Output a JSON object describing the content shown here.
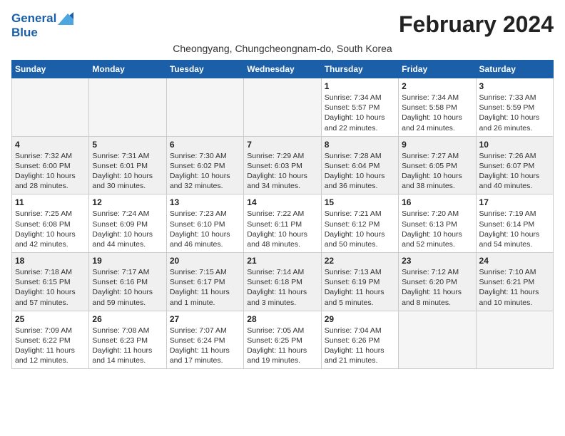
{
  "header": {
    "logo_general": "General",
    "logo_blue": "Blue",
    "month_title": "February 2024",
    "subtitle": "Cheongyang, Chungcheongnam-do, South Korea"
  },
  "weekdays": [
    "Sunday",
    "Monday",
    "Tuesday",
    "Wednesday",
    "Thursday",
    "Friday",
    "Saturday"
  ],
  "weeks": [
    [
      {
        "day": "",
        "info": ""
      },
      {
        "day": "",
        "info": ""
      },
      {
        "day": "",
        "info": ""
      },
      {
        "day": "",
        "info": ""
      },
      {
        "day": "1",
        "info": "Sunrise: 7:34 AM\nSunset: 5:57 PM\nDaylight: 10 hours\nand 22 minutes."
      },
      {
        "day": "2",
        "info": "Sunrise: 7:34 AM\nSunset: 5:58 PM\nDaylight: 10 hours\nand 24 minutes."
      },
      {
        "day": "3",
        "info": "Sunrise: 7:33 AM\nSunset: 5:59 PM\nDaylight: 10 hours\nand 26 minutes."
      }
    ],
    [
      {
        "day": "4",
        "info": "Sunrise: 7:32 AM\nSunset: 6:00 PM\nDaylight: 10 hours\nand 28 minutes."
      },
      {
        "day": "5",
        "info": "Sunrise: 7:31 AM\nSunset: 6:01 PM\nDaylight: 10 hours\nand 30 minutes."
      },
      {
        "day": "6",
        "info": "Sunrise: 7:30 AM\nSunset: 6:02 PM\nDaylight: 10 hours\nand 32 minutes."
      },
      {
        "day": "7",
        "info": "Sunrise: 7:29 AM\nSunset: 6:03 PM\nDaylight: 10 hours\nand 34 minutes."
      },
      {
        "day": "8",
        "info": "Sunrise: 7:28 AM\nSunset: 6:04 PM\nDaylight: 10 hours\nand 36 minutes."
      },
      {
        "day": "9",
        "info": "Sunrise: 7:27 AM\nSunset: 6:05 PM\nDaylight: 10 hours\nand 38 minutes."
      },
      {
        "day": "10",
        "info": "Sunrise: 7:26 AM\nSunset: 6:07 PM\nDaylight: 10 hours\nand 40 minutes."
      }
    ],
    [
      {
        "day": "11",
        "info": "Sunrise: 7:25 AM\nSunset: 6:08 PM\nDaylight: 10 hours\nand 42 minutes."
      },
      {
        "day": "12",
        "info": "Sunrise: 7:24 AM\nSunset: 6:09 PM\nDaylight: 10 hours\nand 44 minutes."
      },
      {
        "day": "13",
        "info": "Sunrise: 7:23 AM\nSunset: 6:10 PM\nDaylight: 10 hours\nand 46 minutes."
      },
      {
        "day": "14",
        "info": "Sunrise: 7:22 AM\nSunset: 6:11 PM\nDaylight: 10 hours\nand 48 minutes."
      },
      {
        "day": "15",
        "info": "Sunrise: 7:21 AM\nSunset: 6:12 PM\nDaylight: 10 hours\nand 50 minutes."
      },
      {
        "day": "16",
        "info": "Sunrise: 7:20 AM\nSunset: 6:13 PM\nDaylight: 10 hours\nand 52 minutes."
      },
      {
        "day": "17",
        "info": "Sunrise: 7:19 AM\nSunset: 6:14 PM\nDaylight: 10 hours\nand 54 minutes."
      }
    ],
    [
      {
        "day": "18",
        "info": "Sunrise: 7:18 AM\nSunset: 6:15 PM\nDaylight: 10 hours\nand 57 minutes."
      },
      {
        "day": "19",
        "info": "Sunrise: 7:17 AM\nSunset: 6:16 PM\nDaylight: 10 hours\nand 59 minutes."
      },
      {
        "day": "20",
        "info": "Sunrise: 7:15 AM\nSunset: 6:17 PM\nDaylight: 11 hours\nand 1 minute."
      },
      {
        "day": "21",
        "info": "Sunrise: 7:14 AM\nSunset: 6:18 PM\nDaylight: 11 hours\nand 3 minutes."
      },
      {
        "day": "22",
        "info": "Sunrise: 7:13 AM\nSunset: 6:19 PM\nDaylight: 11 hours\nand 5 minutes."
      },
      {
        "day": "23",
        "info": "Sunrise: 7:12 AM\nSunset: 6:20 PM\nDaylight: 11 hours\nand 8 minutes."
      },
      {
        "day": "24",
        "info": "Sunrise: 7:10 AM\nSunset: 6:21 PM\nDaylight: 11 hours\nand 10 minutes."
      }
    ],
    [
      {
        "day": "25",
        "info": "Sunrise: 7:09 AM\nSunset: 6:22 PM\nDaylight: 11 hours\nand 12 minutes."
      },
      {
        "day": "26",
        "info": "Sunrise: 7:08 AM\nSunset: 6:23 PM\nDaylight: 11 hours\nand 14 minutes."
      },
      {
        "day": "27",
        "info": "Sunrise: 7:07 AM\nSunset: 6:24 PM\nDaylight: 11 hours\nand 17 minutes."
      },
      {
        "day": "28",
        "info": "Sunrise: 7:05 AM\nSunset: 6:25 PM\nDaylight: 11 hours\nand 19 minutes."
      },
      {
        "day": "29",
        "info": "Sunrise: 7:04 AM\nSunset: 6:26 PM\nDaylight: 11 hours\nand 21 minutes."
      },
      {
        "day": "",
        "info": ""
      },
      {
        "day": "",
        "info": ""
      }
    ]
  ],
  "row_backgrounds": [
    "#fff",
    "#f0f0f0",
    "#fff",
    "#f0f0f0",
    "#fff"
  ]
}
